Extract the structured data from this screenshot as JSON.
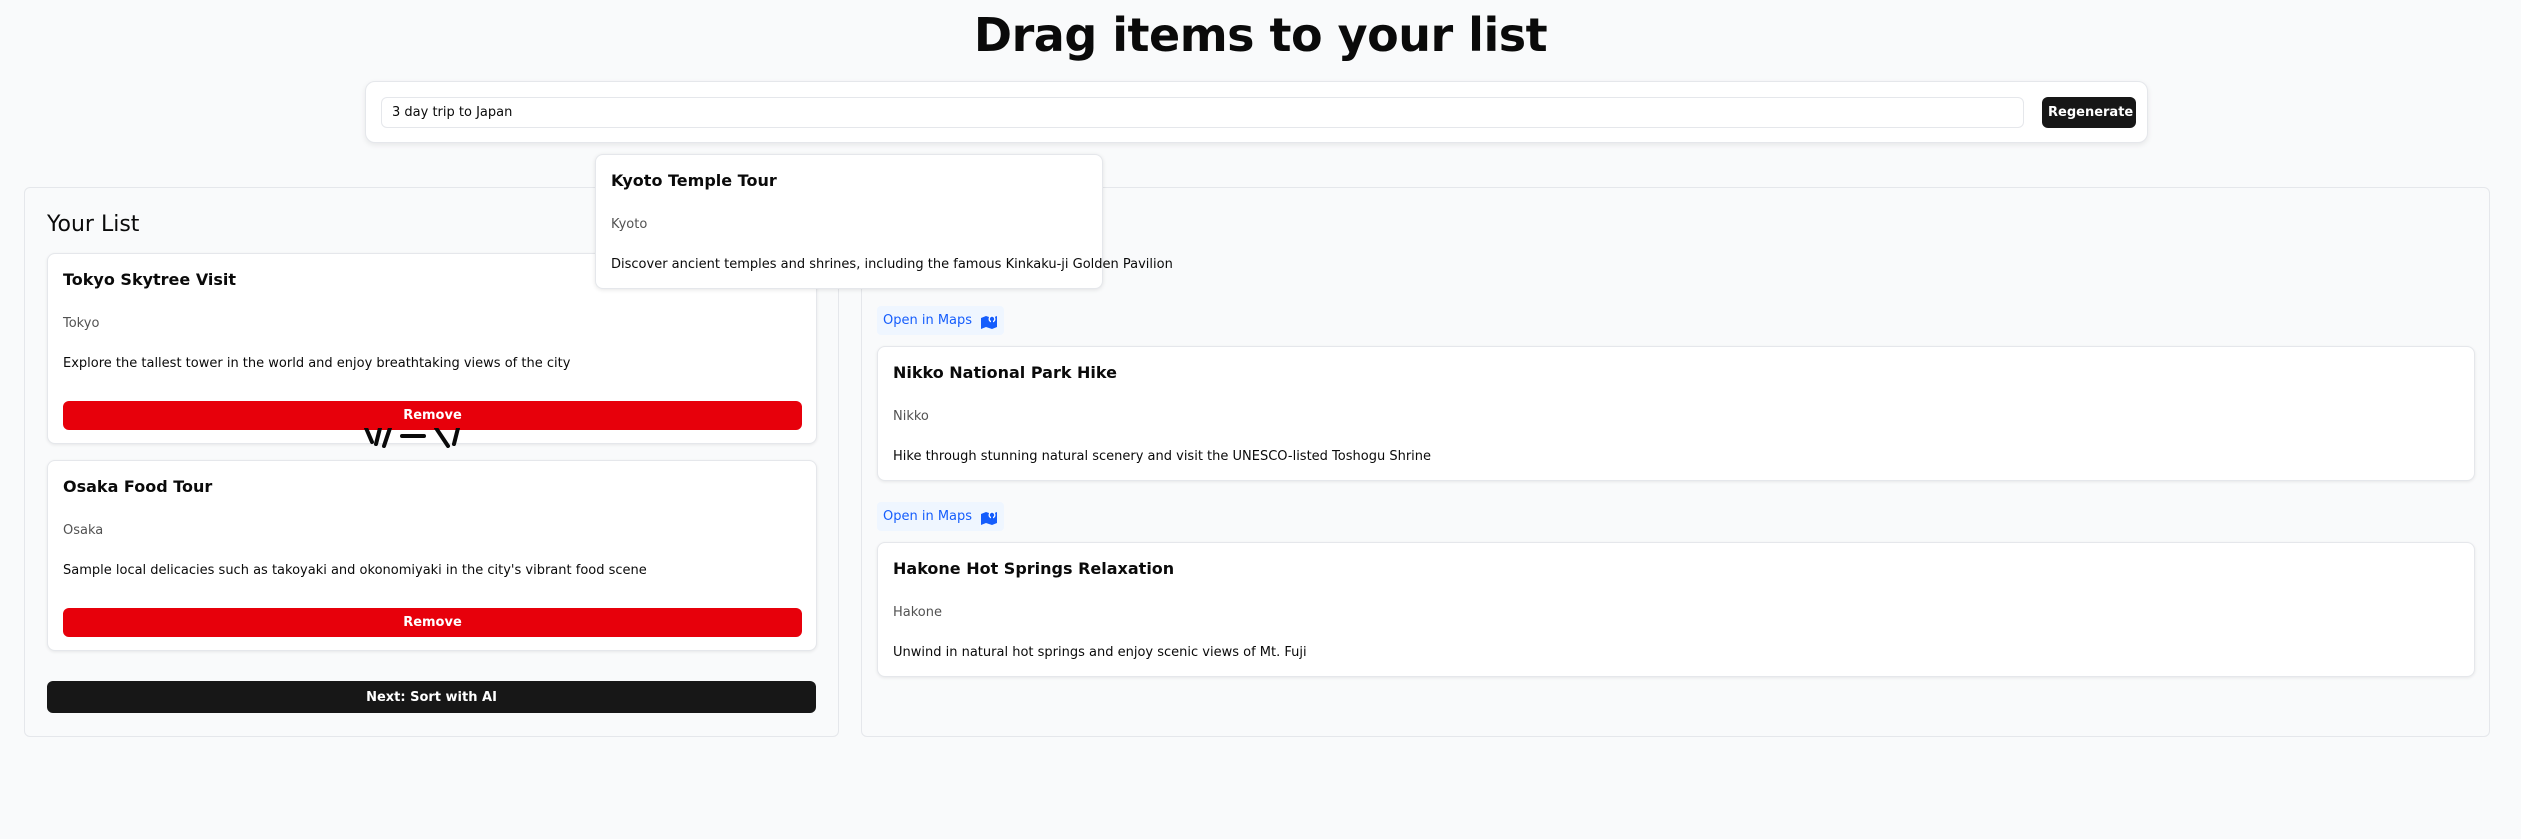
{
  "header": {
    "title": "Drag items to your list"
  },
  "prompt": {
    "value": "3 day trip to Japan",
    "regenerate_label": "Regenerate"
  },
  "list_panel": {
    "title": "Your List",
    "items": [
      {
        "title": "Tokyo Skytree Visit",
        "city": "Tokyo",
        "description": "Explore the tallest tower in the world and enjoy breathtaking views of the city",
        "remove_label": "Remove"
      },
      {
        "title": "Osaka Food Tour",
        "city": "Osaka",
        "description": "Sample local delicacies such as takoyaki and okonomiyaki in the city's vibrant food scene",
        "remove_label": "Remove"
      }
    ],
    "next_label": "Next: Sort with AI"
  },
  "dragging": {
    "title": "Kyoto Temple Tour",
    "city": "Kyoto",
    "description": "Discover ancient temples and shrines, including the famous Kinkaku-ji Golden Pavilion"
  },
  "suggestions": {
    "items": [
      {
        "maps_label": "Open in Maps",
        "icon": "map-pin-icon",
        "title": "Nikko National Park Hike",
        "city": "Nikko",
        "description": "Hike through stunning natural scenery and visit the UNESCO-listed Toshogu Shrine"
      },
      {
        "maps_label": "Open in Maps",
        "icon": "map-pin-icon",
        "title": "Hakone Hot Springs Relaxation",
        "city": "Hakone",
        "description": "Unwind in natural hot springs and enjoy scenic views of Mt. Fuji"
      }
    ]
  },
  "colors": {
    "primary_dark": "#171717",
    "danger": "#e7000b",
    "link": "#155dfc",
    "link_bg": "#eff6ff",
    "background": "#f9fafb"
  }
}
